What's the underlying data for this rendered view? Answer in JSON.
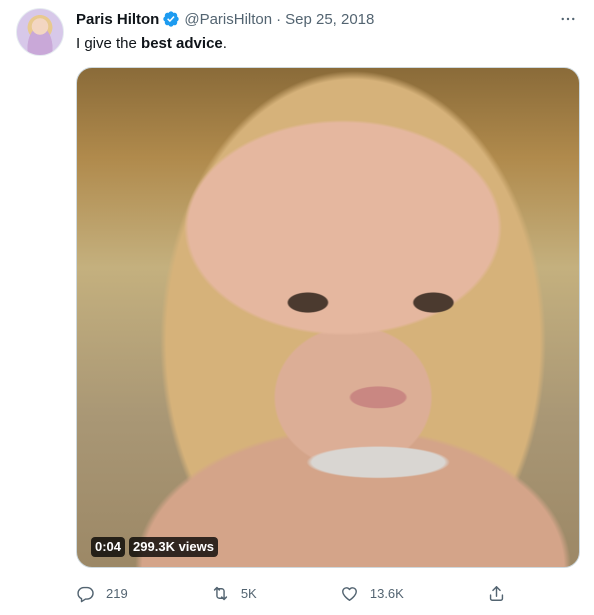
{
  "tweet": {
    "author_name": "Paris Hilton",
    "handle": "@ParisHilton",
    "separator": "·",
    "date": "Sep 25, 2018",
    "text_prefix": "I give the ",
    "text_bold": "best advice",
    "text_suffix": "."
  },
  "video": {
    "time": "0:04",
    "views": "299.3K views"
  },
  "actions": {
    "reply_count": "219",
    "retweet_count": "5K",
    "like_count": "13.6K"
  },
  "icons": {
    "verified": "verified-badge-icon",
    "more": "more-icon",
    "reply": "reply-icon",
    "retweet": "retweet-icon",
    "like": "heart-icon",
    "share": "share-icon"
  },
  "colors": {
    "verified_blue": "#1d9bf0",
    "secondary_text": "#536471"
  }
}
